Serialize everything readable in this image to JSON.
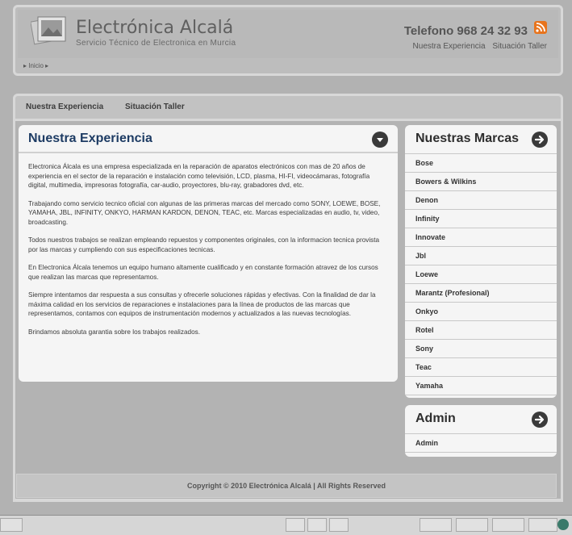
{
  "header": {
    "title": "Electrónica Alcalá",
    "subtitle": "Servicio Técnico de Electronica en Murcia",
    "phone": "Telefono 968 24 32 93",
    "links": [
      "Nuestra Experiencia",
      "Situación Taller"
    ],
    "breadcrumb": "▸ Inicio ▸",
    "rss_color": "#e8741d"
  },
  "nav": {
    "items": [
      "Nuestra Experiencia",
      "Situación Taller"
    ]
  },
  "main": {
    "title": "Nuestra Experiencia",
    "paragraphs": [
      "Electronica Álcala es una empresa especializada en la reparación de aparatos electrónicos con mas de 20 años de experiencia en el sector de la reparación e instalación como televisión, LCD, plasma, HI-FI, videocámaras, fotografía digital, multimedia, impresoras fotografía, car-audio, proyectores, blu-ray, grabadores dvd, etc.",
      "Trabajando como servicio tecnico oficial con algunas de las primeras marcas del mercado como SONY, LOEWE, BOSE, YAMAHA, JBL, INFINITY, ONKYO, HARMAN KARDON, DENON, TEAC, etc. Marcas especializadas en audio, tv, video, broadcasting.",
      "Todos nuestros trabajos se realizan empleando repuestos y componentes originales, con la informacion tecnica provista por las marcas y cumpliendo con sus especificaciones tecnicas.",
      "En Electronica Álcala tenemos un equipo humano altamente cualificado y en constante formación atravez de los cursos que realizan las marcas que representamos.",
      "Siempre intentamos dar respuesta a sus consultas y ofrecerle soluciones rápidas y efectivas. Con la finalidad de dar la máxima calidad en los servicios de reparaciones e instalaciones para la línea de productos de las marcas que representamos, contamos con equipos de instrumentación modernos y actualizados a las nuevas tecnologías.",
      "Brindamos absoluta garantia sobre los trabajos realizados."
    ]
  },
  "brands": {
    "title": "Nuestras Marcas",
    "items": [
      "Bose",
      "Bowers & Wilkins",
      "Denon",
      "Infinity",
      "Innovate",
      "Jbl",
      "Loewe",
      "Marantz (Profesional)",
      "Onkyo",
      "Rotel",
      "Sony",
      "Teac",
      "Yamaha"
    ]
  },
  "admin": {
    "title": "Admin",
    "items": [
      "Admin"
    ]
  },
  "footer": {
    "text": "Copyright © 2010 Electrónica Alcalá  |  All Rights Reserved"
  }
}
